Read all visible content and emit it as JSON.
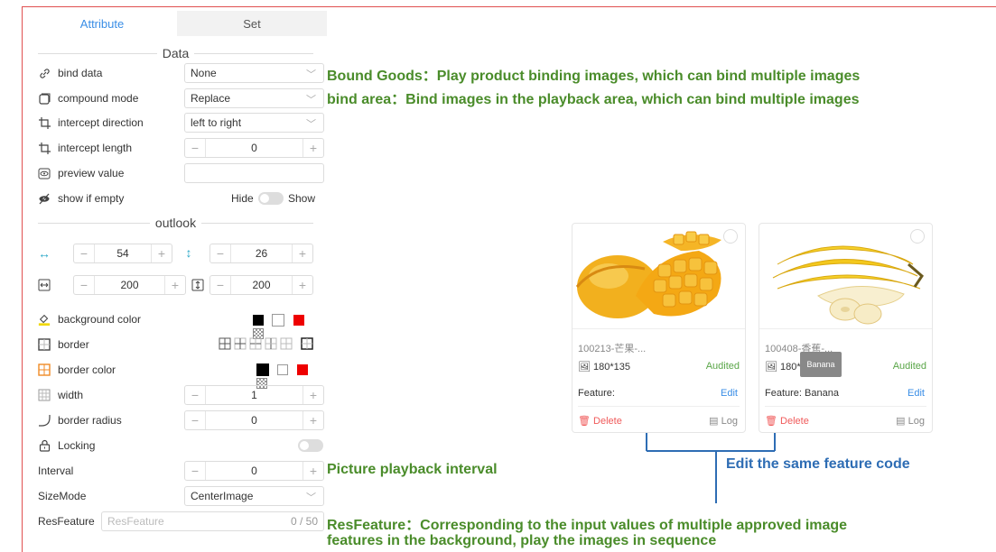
{
  "tabs": [
    "Attribute",
    "Set"
  ],
  "sections": {
    "data": "Data",
    "outlook": "outlook"
  },
  "fields": {
    "bind_data": {
      "label": "bind data",
      "value": "None"
    },
    "compound_mode": {
      "label": "compound mode",
      "value": "Replace"
    },
    "intercept_direction": {
      "label": "intercept direction",
      "value": "left to right"
    },
    "intercept_length": {
      "label": "intercept length",
      "value": "0"
    },
    "preview_value": {
      "label": "preview value",
      "value": ""
    },
    "show_if_empty": {
      "label": "show if empty",
      "off": "Hide",
      "on": "Show"
    },
    "x": "54",
    "y": "26",
    "w": "200",
    "h": "200",
    "background_color": {
      "label": "background color"
    },
    "border": {
      "label": "border"
    },
    "border_color": {
      "label": "border color"
    },
    "width": {
      "label": "width",
      "value": "1"
    },
    "border_radius": {
      "label": "border radius",
      "value": "0"
    },
    "locking": {
      "label": "Locking"
    },
    "interval": {
      "label": "Interval",
      "value": "0"
    },
    "size_mode": {
      "label": "SizeMode",
      "value": "CenterImage"
    },
    "res_feature": {
      "label": "ResFeature",
      "placeholder": "ResFeature",
      "count": "0 / 50"
    }
  },
  "annotations": {
    "bound_goods": "Bound Goods：Play product binding images, which can bind multiple images",
    "bind_area": "bind area：Bind images in the playback area, which can bind multiple images",
    "interval": "Picture playback interval",
    "edit_same": "Edit the same feature code",
    "resfeature_1": "ResFeature：Corresponding to the input values of multiple approved image",
    "resfeature_2": "features in the background, play the images in sequence"
  },
  "cards": [
    {
      "code": "100213-芒果-...",
      "size": "180*135",
      "status": "Audited",
      "feature": "Feature:",
      "edit": "Edit",
      "delete": "Delete",
      "log": "Log"
    },
    {
      "code": "100408-香蕉-...",
      "size": "180*135",
      "status": "Audited",
      "feature": "Feature: Banana",
      "edit": "Edit",
      "delete": "Delete",
      "log": "Log"
    }
  ],
  "tooltip": "Banana",
  "colors": {
    "accent": "#3a8ee6",
    "annotation_green": "#4a8c2a",
    "annotation_blue": "#2e6db4",
    "audited": "#5aa648",
    "delete": "#f05a5a"
  }
}
